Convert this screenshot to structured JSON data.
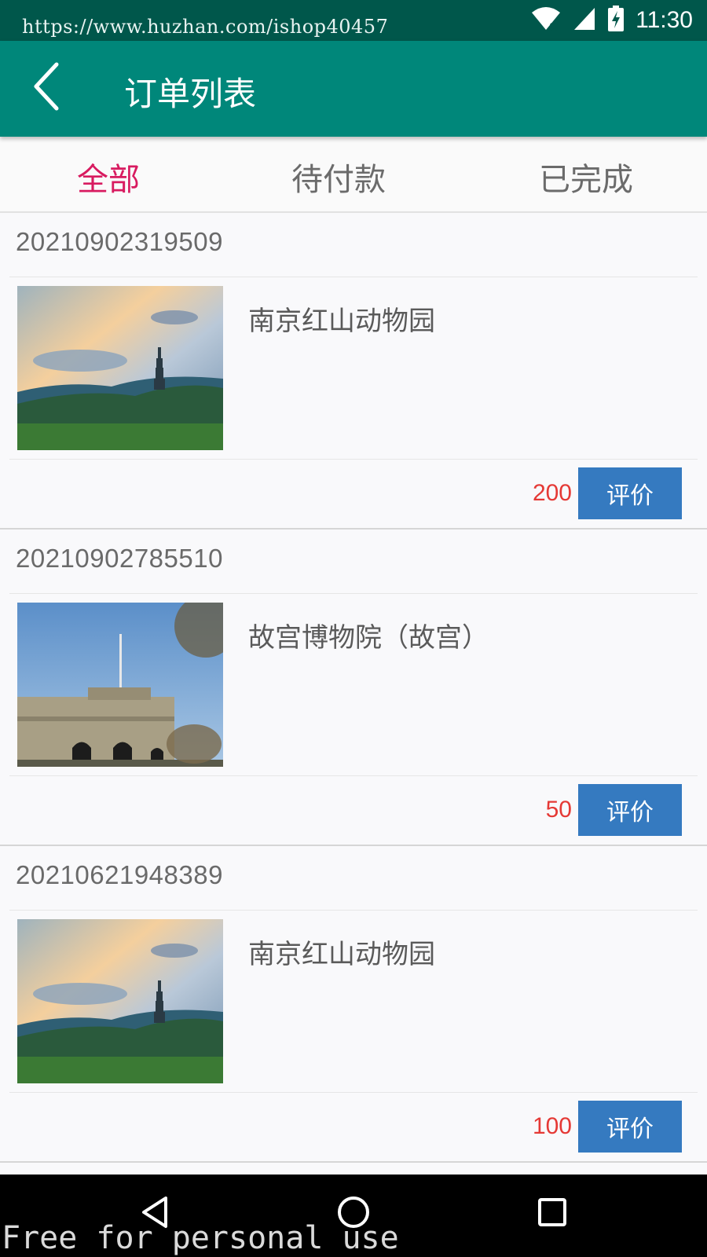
{
  "status_bar": {
    "url": "https://www.huzhan.com/ishop40457",
    "time": "11:30",
    "icons": [
      "wifi-icon",
      "cellular-signal-icon",
      "battery-charging-icon"
    ]
  },
  "toolbar": {
    "back_icon": "chevron-left-icon",
    "title": "订单列表"
  },
  "tabs": [
    {
      "label": "全部",
      "active": true
    },
    {
      "label": "待付款",
      "active": false
    },
    {
      "label": "已完成",
      "active": false
    }
  ],
  "orders": [
    {
      "order_no": "20210902319509",
      "name": "南京红山动物园",
      "price": "200",
      "button": "评价",
      "image": "pagoda-landscape-photo"
    },
    {
      "order_no": "20210902785510",
      "name": "故宫博物院（故宫）",
      "price": "50",
      "button": "评价",
      "image": "historic-building-photo"
    },
    {
      "order_no": "20210621948389",
      "name": "南京红山动物园",
      "price": "100",
      "button": "评价",
      "image": "pagoda-landscape-photo"
    }
  ],
  "nav_bar": {
    "icons": [
      "back-triangle-icon",
      "home-circle-icon",
      "recents-square-icon"
    ]
  },
  "watermark": "Free for personal use",
  "colors": {
    "status_bar": "#00574b",
    "toolbar": "#00877a",
    "active_tab": "#d81b60",
    "price": "#e53935",
    "button": "#357ac0"
  }
}
